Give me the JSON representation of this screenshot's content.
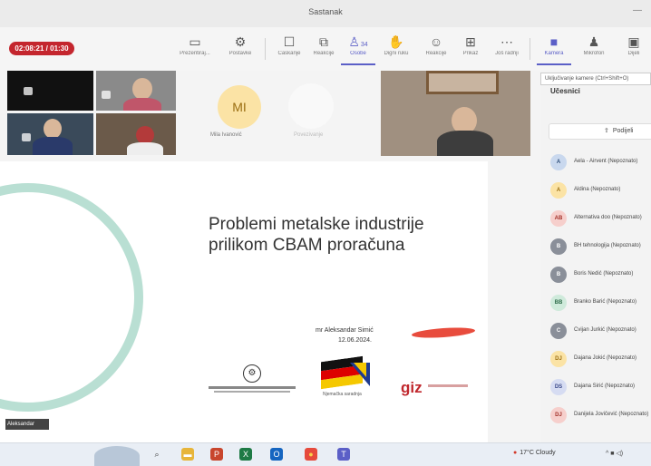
{
  "window": {
    "title": "Sastanak",
    "minimize": "—"
  },
  "timer": "02:08:21 / 01:30",
  "toolbar": {
    "buttons": [
      {
        "id": "present",
        "label": "Prezentiraj...",
        "icon": "present-icon"
      },
      {
        "id": "settings",
        "label": "Postavke",
        "icon": "gear-icon"
      },
      {
        "id": "chat",
        "label": "Ćaskanje",
        "icon": "chat-icon"
      },
      {
        "id": "people",
        "label": "Osobe",
        "icon": "people-icon",
        "count": "34"
      },
      {
        "id": "hand",
        "label": "Digni ruku",
        "icon": "hand-icon"
      },
      {
        "id": "react",
        "label": "Reakcije",
        "icon": "emoji-icon"
      },
      {
        "id": "view",
        "label": "Prikaz",
        "icon": "grid-view-icon"
      },
      {
        "id": "more",
        "label": "Još radnji",
        "icon": "more-icon"
      },
      {
        "id": "camera",
        "label": "Kamera",
        "icon": "camera-icon"
      },
      {
        "id": "mic",
        "label": "Mikrofon",
        "icon": "mic-icon"
      },
      {
        "id": "share",
        "label": "Dijeli",
        "icon": "share-tray-icon"
      }
    ],
    "tooltip": "Uključivanje kamere (Ctrl+Shift+O)"
  },
  "stage": {
    "avatar_mi": {
      "initials": "MI",
      "name": "Mila Ivanović"
    },
    "avatar_ghost": {
      "name": "Povezivanje"
    }
  },
  "slide": {
    "title_line1": "Problemi metalske industrije",
    "title_line2": "prilikom CBAM proračuna",
    "presenter": "mr Aleksandar Simić",
    "date": "12.06.2024.",
    "coop_label": "Njemačka saradnja",
    "giz": "giz",
    "presenter_tag": "Aleksandar"
  },
  "panel": {
    "header": "Učesnici",
    "share_label": "Podijeli",
    "participants": [
      {
        "initials": "A",
        "name": "Aela - Airvent (Nepoznato)",
        "bg": "#c9d8ee",
        "fg": "#2f4f7a"
      },
      {
        "initials": "A",
        "name": "Aldina (Nepoznato)",
        "bg": "#fbe3a5",
        "fg": "#9a6e12"
      },
      {
        "initials": "AB",
        "name": "Alternativa doo (Nepoznato)",
        "bg": "#f6cfcc",
        "fg": "#a23028"
      },
      {
        "initials": "B",
        "name": "BH tehnologija (Nepoznato)",
        "bg": "#8a8f99",
        "fg": "#ffffff"
      },
      {
        "initials": "B",
        "name": "Boris Nedić (Nepoznato)",
        "bg": "#8a8f99",
        "fg": "#ffffff"
      },
      {
        "initials": "BB",
        "name": "Branko Barić (Nepoznato)",
        "bg": "#cfeadb",
        "fg": "#2d6b49"
      },
      {
        "initials": "C",
        "name": "Cvijan Jurkić (Nepoznato)",
        "bg": "#8a8f99",
        "fg": "#ffffff"
      },
      {
        "initials": "DJ",
        "name": "Dajana Jokić (Nepoznato)",
        "bg": "#fbe3a5",
        "fg": "#9a6e12"
      },
      {
        "initials": "DS",
        "name": "Dajana Sirić (Nepoznato)",
        "bg": "#d6dcf2",
        "fg": "#3c4a8a"
      },
      {
        "initials": "DJ",
        "name": "Danijela Jovičević (Nepoznato)",
        "bg": "#f6cfcc",
        "fg": "#a23028"
      }
    ]
  },
  "taskbar": {
    "icons": [
      {
        "name": "search-icon",
        "glyph": "⌕",
        "bg": "transparent",
        "fg": "#444"
      },
      {
        "name": "file-explorer-icon",
        "glyph": "▬",
        "bg": "#e7b53a",
        "fg": "#fff"
      },
      {
        "name": "powerpoint-icon",
        "glyph": "P",
        "bg": "#c8462d",
        "fg": "#fff"
      },
      {
        "name": "excel-icon",
        "glyph": "X",
        "bg": "#1e7a45",
        "fg": "#fff"
      },
      {
        "name": "outlook-icon",
        "glyph": "O",
        "bg": "#1565c0",
        "fg": "#fff"
      },
      {
        "name": "chrome-icon",
        "glyph": "●",
        "bg": "#e64a3c",
        "fg": "#f8d04a"
      },
      {
        "name": "teams-icon",
        "glyph": "T",
        "bg": "#5b5fc7",
        "fg": "#fff"
      }
    ],
    "weather": "17°C Cloudy",
    "tray": "^ ■ ◁)"
  }
}
